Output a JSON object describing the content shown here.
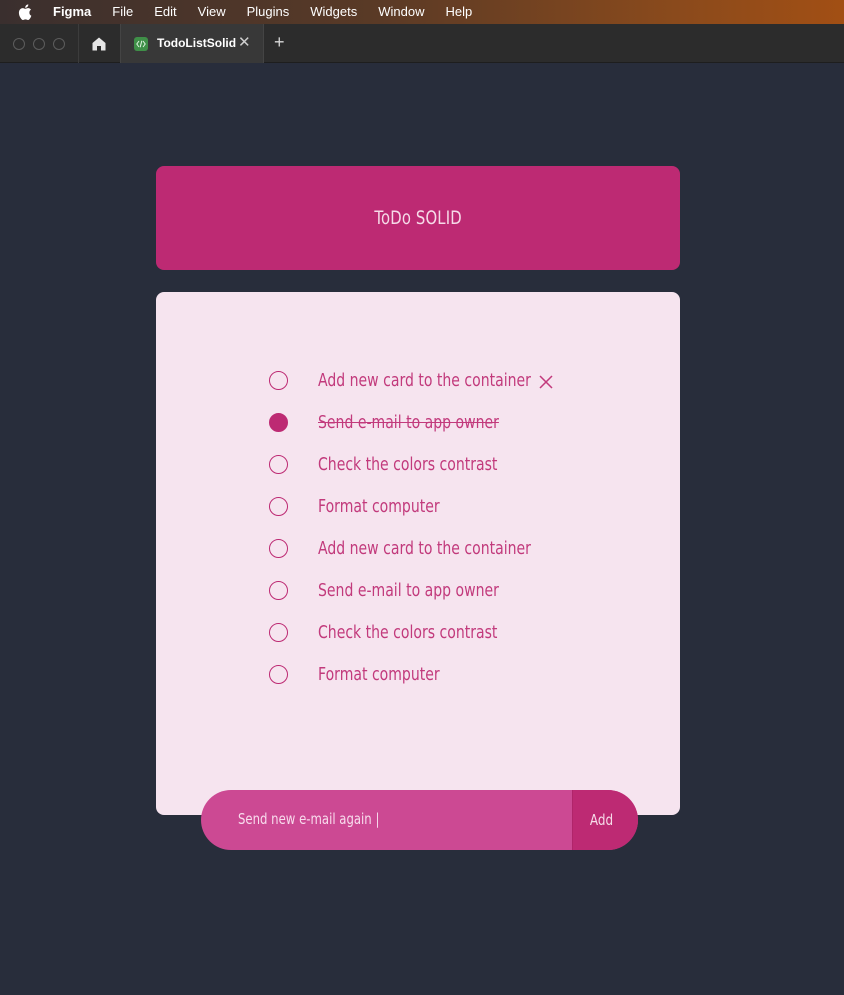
{
  "menubar": {
    "items": [
      {
        "label": "Figma",
        "bold": true
      },
      {
        "label": "File"
      },
      {
        "label": "Edit"
      },
      {
        "label": "View"
      },
      {
        "label": "Plugins"
      },
      {
        "label": "Widgets"
      },
      {
        "label": "Window"
      },
      {
        "label": "Help"
      }
    ]
  },
  "tabbar": {
    "active_tab": {
      "title": "TodoListSolid",
      "close": "✕"
    },
    "new_tab": "+"
  },
  "widget": {
    "title": "ToDo SOLID",
    "todos": [
      {
        "label": "Add new card to the container",
        "done": false
      },
      {
        "label": "Send e-mail to app owner",
        "done": true
      },
      {
        "label": "Check the colors contrast",
        "done": false
      },
      {
        "label": "Format computer",
        "done": false
      },
      {
        "label": "Add new card to the container",
        "done": false
      },
      {
        "label": "Send e-mail to app owner",
        "done": false
      },
      {
        "label": "Check the colors contrast",
        "done": false
      },
      {
        "label": "Format computer",
        "done": false
      }
    ],
    "input_value": "Send new e-mail again |",
    "add_label": "Add"
  },
  "colors": {
    "background": "#282d3b",
    "accent": "#bd2a73",
    "card": "#f6e4ef",
    "input": "#cc4993"
  }
}
